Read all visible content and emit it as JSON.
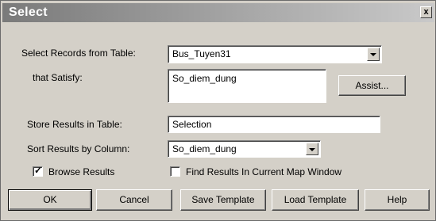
{
  "window": {
    "title": "Select",
    "close_glyph": "x"
  },
  "select_records": {
    "label": "Select Records from Table:",
    "value": "Bus_Tuyen31"
  },
  "that_satisfy": {
    "label": "that Satisfy:",
    "value": "So_diem_dung"
  },
  "assist_label": "Assist...",
  "store_results": {
    "label": "Store Results in Table:",
    "value": "Selection"
  },
  "sort_results": {
    "label": "Sort Results by Column:",
    "value": "So_diem_dung"
  },
  "browse_results": {
    "label": "Browse Results",
    "checked": true,
    "mark": "✓"
  },
  "find_results": {
    "label": "Find Results In Current Map Window",
    "checked": false
  },
  "buttons": {
    "ok": "OK",
    "cancel": "Cancel",
    "save_template": "Save Template",
    "load_template": "Load Template",
    "help": "Help"
  }
}
